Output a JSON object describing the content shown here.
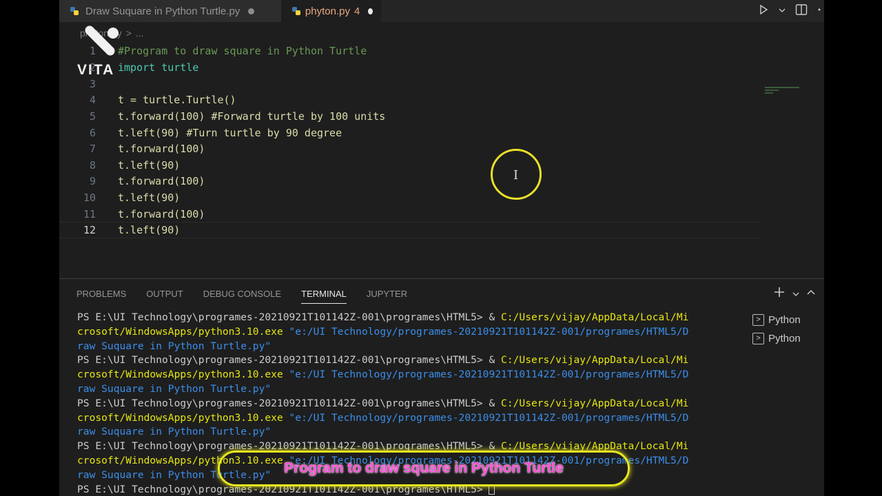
{
  "tabs": [
    {
      "label": "Draw Suquare in Python Turtle.py",
      "badge": "",
      "active": false
    },
    {
      "label": "phyton.py",
      "badge": "4",
      "active": true
    }
  ],
  "tab_actions": {
    "run_icon": "play-icon",
    "layout_icon": "split-editor-icon",
    "more_icon": "more-icon"
  },
  "breadcrumb": {
    "file": "phyton.py",
    "separator": ">",
    "rest": "..."
  },
  "watermark": {
    "text": "VITA"
  },
  "editor": {
    "lines": [
      {
        "n": "1",
        "text": "#Program to draw square in Python Turtle"
      },
      {
        "n": "2",
        "text": "import turtle"
      },
      {
        "n": "3",
        "text": ""
      },
      {
        "n": "4",
        "text": "t = turtle.Turtle()"
      },
      {
        "n": "5",
        "text": "t.forward(100) #Forward turtle by 100 units"
      },
      {
        "n": "6",
        "text": "t.left(90) #Turn turtle by 90 degree"
      },
      {
        "n": "7",
        "text": "t.forward(100)"
      },
      {
        "n": "8",
        "text": "t.left(90)"
      },
      {
        "n": "9",
        "text": "t.forward(100)"
      },
      {
        "n": "10",
        "text": "t.left(90)"
      },
      {
        "n": "11",
        "text": "t.forward(100)"
      },
      {
        "n": "12",
        "text": "t.left(90)"
      }
    ]
  },
  "panel": {
    "tabs": [
      "PROBLEMS",
      "OUTPUT",
      "DEBUG CONSOLE",
      "TERMINAL",
      "JUPYTER"
    ],
    "active_tab": "TERMINAL",
    "terminals": [
      "Python",
      "Python"
    ]
  },
  "terminal": {
    "prompt": "PS E:\\UI Technology\\programes-20210921T101142Z-001\\programes\\HTML5> ",
    "amp": "& ",
    "exe_part1": "C:/Users/vijay/AppData/Local/Mi",
    "exe_part2": "crosoft/WindowsApps/python3.10.exe",
    "arg_part1": " \"e:/UI Technology/programes-20210921T101142Z-001/programes/HTML5/D",
    "arg_part2": "raw Suquare in Python Turtle.py\""
  },
  "caption": {
    "text": "Program to draw square in Python Turtle"
  },
  "colors": {
    "caption_border": "#e6e620",
    "caption_text": "#ff4fd8",
    "cursor_ring": "#e8e02a"
  }
}
